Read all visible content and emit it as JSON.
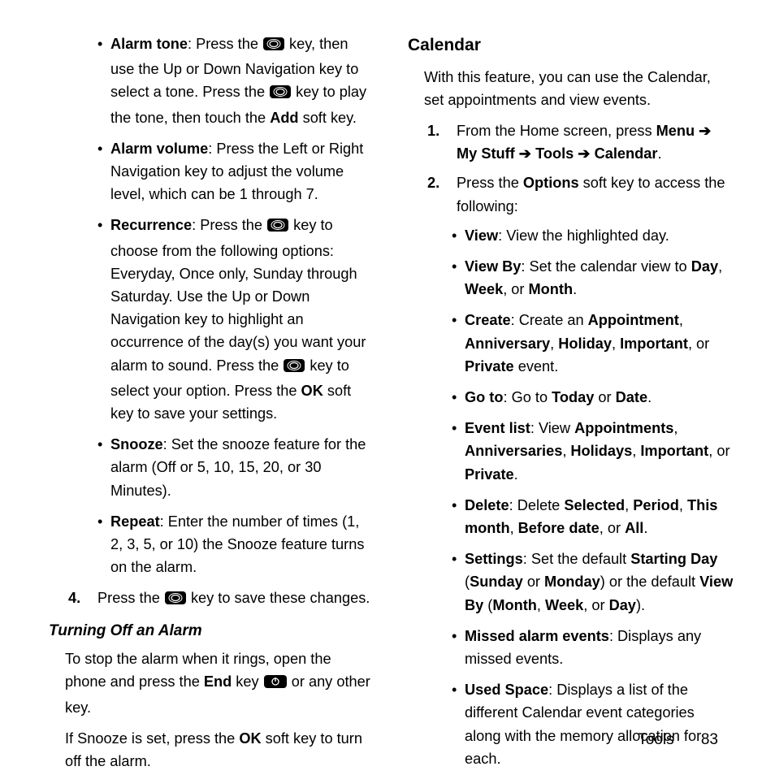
{
  "left": {
    "bullets": {
      "alarm_tone": {
        "label": "Alarm tone",
        "t1": ": Press the ",
        "t2": " key, then use the Up or Down Navigation key to select a tone. Press the ",
        "t3": " key to play the tone, then touch the ",
        "add": "Add",
        "t4": " soft key."
      },
      "alarm_volume": {
        "label": "Alarm volume",
        "text": ": Press the Left or Right Navigation key to adjust the volume level, which can be 1 through 7."
      },
      "recurrence": {
        "label": "Recurrence",
        "t1": ": Press the ",
        "t2": " key to choose from the following options: Everyday, Once only, Sunday through Saturday. Use the Up or Down Navigation key to highlight an occurrence of the day(s) you want your alarm to sound. Press the ",
        "t3": " key to select your option. Press the ",
        "ok": "OK",
        "t4": " soft key to save your settings."
      },
      "snooze": {
        "label": "Snooze",
        "text": ": Set the snooze feature for the alarm (Off or 5, 10, 15, 20, or 30 Minutes)."
      },
      "repeat": {
        "label": "Repeat",
        "text": ": Enter the number of times (1, 2, 3, 5, or 10) the Snooze feature turns on the alarm."
      }
    },
    "step4": {
      "num": "4.",
      "t1": "Press the ",
      "t2": " key to save these changes."
    },
    "turning_off_heading": "Turning Off an Alarm",
    "p1_a": "To stop the alarm when it rings, open the phone and press the ",
    "p1_end": "End",
    "p1_b": " key ",
    "p1_c": " or any other key.",
    "p2_a": "If Snooze is set, press the ",
    "p2_ok": "OK",
    "p2_b": " soft key to turn off the alarm."
  },
  "right": {
    "heading": "Calendar",
    "intro": "With this feature, you can use the Calendar, set appointments and view events.",
    "step1": {
      "num": "1.",
      "t1": "From the Home screen, press ",
      "menu": "Menu",
      "arrow": " ➔ ",
      "mystuff": "My Stuff",
      "tools": "Tools",
      "calendar": "Calendar",
      "dot": "."
    },
    "step2": {
      "num": "2.",
      "t1": "Press the ",
      "options": "Options",
      "t2": " soft key to access the following:"
    },
    "opts": {
      "view": {
        "label": "View",
        "text": ": View the highlighted day."
      },
      "viewby": {
        "label": "View By",
        "t1": ": Set the calendar view to ",
        "day": "Day",
        "c1": ", ",
        "week": "Week",
        "c2": ", or ",
        "month": "Month",
        "dot": "."
      },
      "create": {
        "label": "Create",
        "t1": ": Create an ",
        "appt": "Appointment",
        "c1": ", ",
        "anniv": "Anniversary",
        "c2": ", ",
        "holiday": "Holiday",
        "c3": ", ",
        "important": "Important",
        "c4": ", or ",
        "private": "Private",
        "t2": " event."
      },
      "goto": {
        "label": "Go to",
        "t1": ": Go to ",
        "today": "Today",
        "c1": " or ",
        "date": "Date",
        "dot": "."
      },
      "eventlist": {
        "label": "Event list",
        "t1": ": View ",
        "appts": "Appointments",
        "c1": ", ",
        "anniv": "Anniversaries",
        "c2": ", ",
        "holidays": "Holidays",
        "c3": ", ",
        "important": "Important",
        "c4": ", or ",
        "private": "Private",
        "dot": "."
      },
      "delete": {
        "label": "Delete",
        "t1": ": Delete ",
        "selected": "Selected",
        "c1": ", ",
        "period": "Period",
        "c2": ", ",
        "thismonth": "This month",
        "c3": ", ",
        "before": "Before date",
        "c4": ", or ",
        "all": "All",
        "dot": "."
      },
      "settings": {
        "label": "Settings",
        "t1": ": Set the default ",
        "starting": "Starting Day",
        "t2": " (",
        "sunday": "Sunday",
        "c1": " or ",
        "monday": "Monday",
        "t3": ") or the default ",
        "viewby": "View By",
        "t4": " (",
        "month": "Month",
        "c2": ", ",
        "week": "Week",
        "c3": ", or ",
        "day": "Day",
        "t5": ")."
      },
      "missed": {
        "label": "Missed alarm events",
        "text": ": Displays any missed events."
      },
      "used": {
        "label": "Used Space",
        "text": ": Displays a list of the different Calendar event categories along with the memory allocation for each."
      }
    }
  },
  "footer": {
    "section": "Tools",
    "page": "83"
  }
}
